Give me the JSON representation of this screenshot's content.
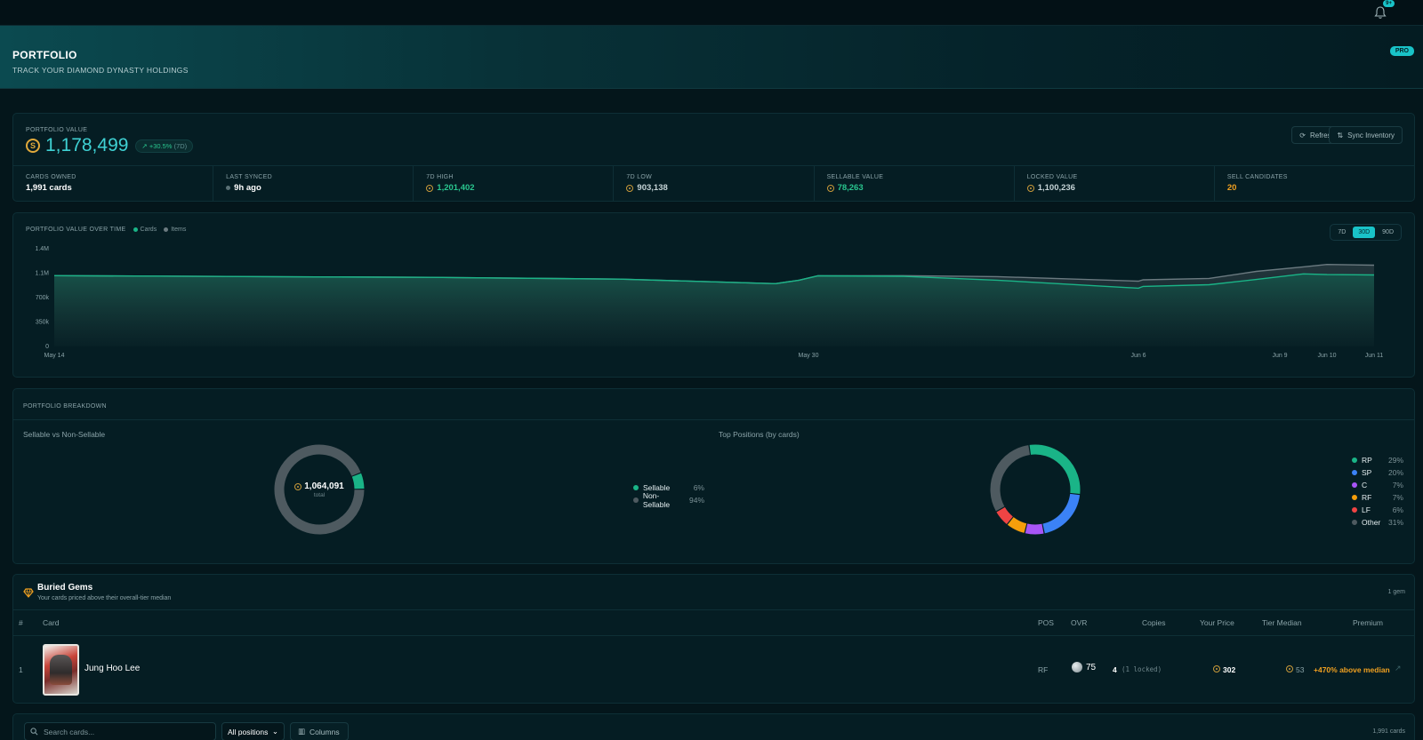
{
  "header": {
    "title": "PORTFOLIO",
    "subtitle": "TRACK YOUR DIAMOND DYNASTY HOLDINGS",
    "badge": "PRO",
    "notif_count": "9+"
  },
  "value_card": {
    "label": "PORTFOLIO VALUE",
    "value": "1,178,499",
    "change": "+30.5%",
    "change_period": "(7D)",
    "refresh_label": "Refresh",
    "sync_label": "Sync Inventory",
    "stats": [
      {
        "label": "CARDS OWNED",
        "value": "1,991 cards",
        "color": "#ffffff",
        "icon": ""
      },
      {
        "label": "LAST SYNCED",
        "value": "9h ago",
        "color": "#ffffff",
        "icon": "status-dot"
      },
      {
        "label": "7D HIGH",
        "value": "1,201,402",
        "color": "#29c58e",
        "icon": "coin"
      },
      {
        "label": "7D LOW",
        "value": "903,138",
        "color": "#c5d3d6",
        "icon": "coin"
      },
      {
        "label": "SELLABLE VALUE",
        "value": "78,263",
        "color": "#29c58e",
        "icon": "coin"
      },
      {
        "label": "LOCKED VALUE",
        "value": "1,100,236",
        "color": "#c5d3d6",
        "icon": "coin"
      },
      {
        "label": "SELL CANDIDATES",
        "value": "20",
        "color": "#f0a020",
        "icon": ""
      }
    ]
  },
  "chart": {
    "title": "PORTFOLIO VALUE OVER TIME",
    "legend": [
      {
        "name": "Cards",
        "color": "#1ab487"
      },
      {
        "name": "Items",
        "color": "#6b7a80"
      }
    ],
    "ranges": [
      {
        "label": "7D",
        "active": false
      },
      {
        "label": "30D",
        "active": true
      },
      {
        "label": "90D",
        "active": false
      }
    ]
  },
  "chart_data": {
    "type": "area",
    "y_ticks": [
      "0",
      "350k",
      "700k",
      "1.1M",
      "1.4M"
    ],
    "ylim": [
      0,
      1400000
    ],
    "x_ticks": [
      {
        "label": "May 14",
        "t": 0
      },
      {
        "label": "May 30",
        "t": 16
      },
      {
        "label": "Jun 6",
        "t": 23
      },
      {
        "label": "Jun 9",
        "t": 26
      },
      {
        "label": "Jun 10",
        "t": 27
      },
      {
        "label": "Jun 11",
        "t": 28
      }
    ],
    "series": [
      {
        "name": "Items",
        "color": "#6b7a80",
        "points": [
          [
            0,
            1015000
          ],
          [
            4,
            1002000
          ],
          [
            8,
            990000
          ],
          [
            12,
            965000
          ],
          [
            15.3,
            900000
          ],
          [
            15.8,
            950000
          ],
          [
            16.2,
            1012000
          ],
          [
            18,
            1015000
          ],
          [
            20,
            1000000
          ],
          [
            23,
            935000
          ],
          [
            23.1,
            955000
          ],
          [
            24.5,
            975000
          ],
          [
            25.5,
            1075000
          ],
          [
            26.5,
            1140000
          ],
          [
            27,
            1175000
          ],
          [
            28,
            1165000
          ]
        ]
      },
      {
        "name": "Cards",
        "color": "#1ab487",
        "points": [
          [
            0,
            1015000
          ],
          [
            4,
            1002000
          ],
          [
            8,
            990000
          ],
          [
            12,
            965000
          ],
          [
            15.3,
            900000
          ],
          [
            15.8,
            950000
          ],
          [
            16.2,
            1012000
          ],
          [
            18,
            1005000
          ],
          [
            20,
            950000
          ],
          [
            23,
            835000
          ],
          [
            23.1,
            860000
          ],
          [
            24.5,
            885000
          ],
          [
            25.5,
            960000
          ],
          [
            26.5,
            1040000
          ],
          [
            27,
            1030000
          ],
          [
            28,
            1025000
          ]
        ]
      }
    ]
  },
  "breakdown": {
    "title": "PORTFOLIO BREAKDOWN",
    "left_title": "Sellable vs Non-Sellable",
    "center_value": "1,064,091",
    "center_label": "total",
    "left_legend": [
      {
        "name": "Sellable",
        "pct": "6%",
        "value": 6,
        "color": "#1ab487"
      },
      {
        "name": "Non-Sellable",
        "pct": "94%",
        "value": 94,
        "color": "#4e5a60"
      }
    ],
    "right_title": "Top Positions (by cards)",
    "right_legend": [
      {
        "name": "RP",
        "pct": "29%",
        "value": 29,
        "color": "#1ab487"
      },
      {
        "name": "SP",
        "pct": "20%",
        "value": 20,
        "color": "#3b82f6"
      },
      {
        "name": "C",
        "pct": "7%",
        "value": 7,
        "color": "#a855f7"
      },
      {
        "name": "RF",
        "pct": "7%",
        "value": 7,
        "color": "#f59e0b"
      },
      {
        "name": "LF",
        "pct": "6%",
        "value": 6,
        "color": "#ef4444"
      },
      {
        "name": "Other",
        "pct": "31%",
        "value": 31,
        "color": "#4e5a60"
      }
    ]
  },
  "gems": {
    "title": "Buried Gems",
    "subtitle": "Your cards priced above their overall-tier median",
    "count": "1 gem",
    "columns": {
      "num": "#",
      "card": "Card",
      "pos": "POS",
      "ovr": "OVR",
      "copies": "Copies",
      "price": "Your Price",
      "median": "Tier Median",
      "premium": "Premium"
    },
    "rows": [
      {
        "num": "1",
        "name": "Jung Hoo Lee",
        "pos": "RF",
        "ovr": "75",
        "copies": "4",
        "locked": "(1 locked)",
        "price": "302",
        "median": "53",
        "premium": "+470% above median"
      }
    ]
  },
  "toolbar": {
    "search_placeholder": "Search cards...",
    "position_select": "All positions",
    "columns_label": "Columns",
    "cards_count": "1,991 cards"
  }
}
